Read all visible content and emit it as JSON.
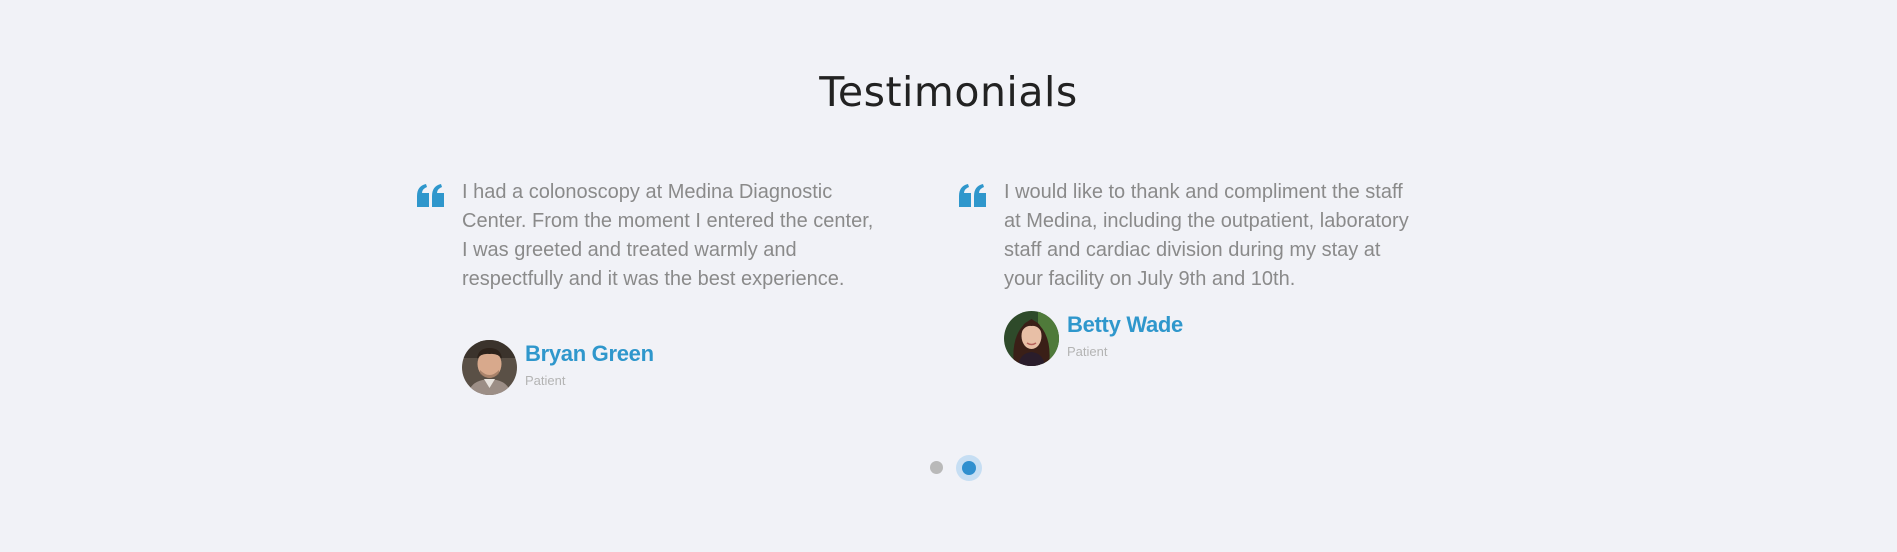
{
  "section": {
    "title": "Testimonials"
  },
  "colors": {
    "background": "#f1f2f7",
    "accent": "#2f97cc",
    "quote_text": "#8a8a8a",
    "role_text": "#b4b4b4"
  },
  "testimonials": [
    {
      "quote": "I had a colonoscopy at Medina Diagnostic Center. From the moment I entered the center, I was greeted and treated warmly and respectfully and it was the best experience.",
      "name": "Bryan Green",
      "role": "Patient",
      "icon": "quote-icon",
      "avatar": "avatar-man"
    },
    {
      "quote": "I would like to thank and compliment the staff at Medina, including the outpatient, laboratory staff and cardiac division during my stay at your facility on July 9th and 10th.",
      "name": "Betty Wade",
      "role": "Patient",
      "icon": "quote-icon",
      "avatar": "avatar-woman"
    }
  ],
  "carousel": {
    "page_count": 2,
    "active_page": 2
  }
}
